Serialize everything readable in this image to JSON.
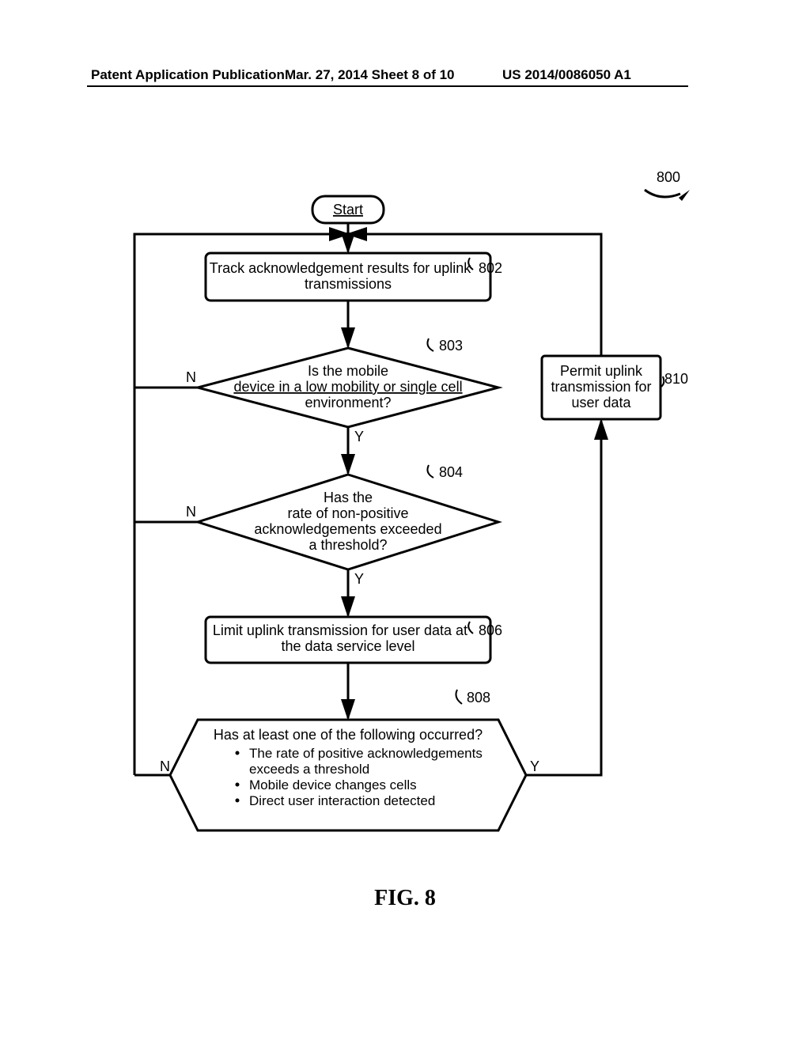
{
  "header": {
    "left": "Patent Application Publication",
    "center": "Mar. 27, 2014  Sheet 8 of 10",
    "right": "US 2014/0086050 A1"
  },
  "flow": {
    "ref800": "800",
    "start": "Start",
    "box802": {
      "line1": "Track acknowledgement results for uplink",
      "line2": "transmissions",
      "ref": "802"
    },
    "d803": {
      "l1": "Is the mobile",
      "l2": "device in a low mobility or single cell",
      "l3": "environment?",
      "ref": "803"
    },
    "d804": {
      "l1": "Has the",
      "l2": "rate of non-positive",
      "l3": "acknowledgements exceeded",
      "l4": "a threshold?",
      "ref": "804"
    },
    "box806": {
      "line1": "Limit uplink transmission for user data at",
      "line2": "the data service level",
      "ref": "806"
    },
    "d808": {
      "head": "Has at least one of the following occurred?",
      "b1": "The rate of positive acknowledgements",
      "b1b": "exceeds a threshold",
      "b2": "Mobile device changes cells",
      "b3": "Direct user interaction detected",
      "ref": "808"
    },
    "box810": {
      "l1": "Permit uplink",
      "l2": "transmission for",
      "l3": "user data",
      "ref": "810"
    },
    "Y": "Y",
    "N": "N"
  },
  "figure_caption": "FIG. 8"
}
